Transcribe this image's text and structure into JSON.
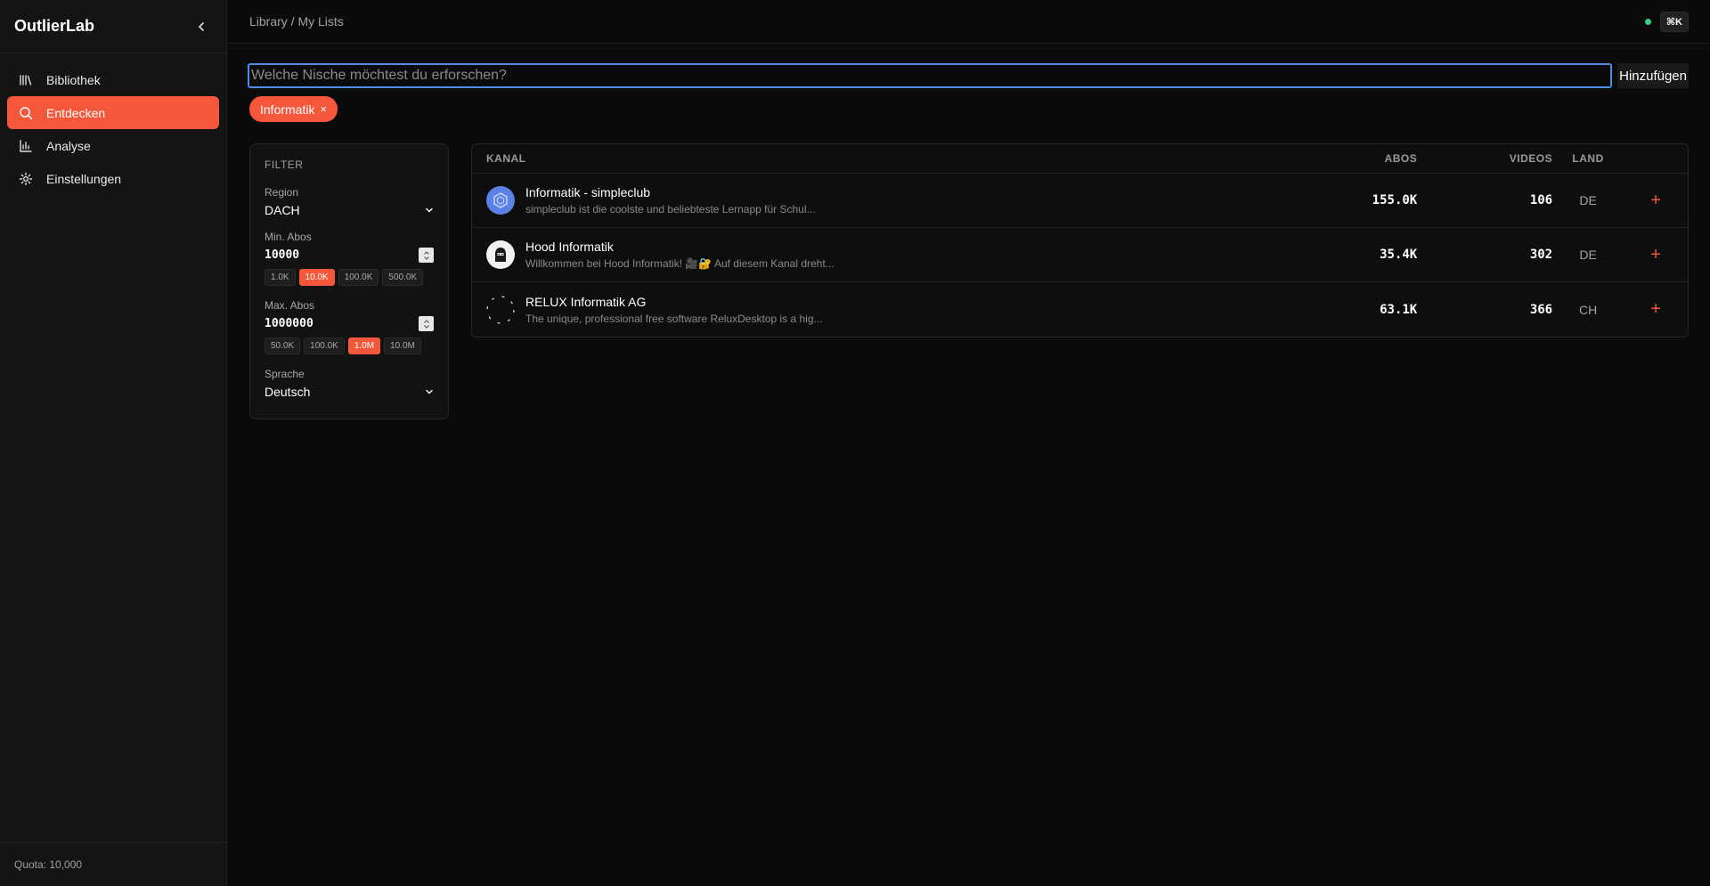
{
  "app": {
    "brand": "OutlierLab"
  },
  "sidebar": {
    "items": [
      {
        "label": "Bibliothek",
        "icon": "library-icon"
      },
      {
        "label": "Entdecken",
        "icon": "search-icon"
      },
      {
        "label": "Analyse",
        "icon": "bar-chart-icon"
      },
      {
        "label": "Einstellungen",
        "icon": "gear-icon"
      }
    ],
    "active": "Entdecken",
    "quota": "Quota: 10,000"
  },
  "topbar": {
    "breadcrumb": "Library / My Lists",
    "shortcut": "⌘K",
    "status_color": "#35d07f"
  },
  "search": {
    "placeholder": "Welche Nische möchtest du erforschen?",
    "value": "",
    "add_label": "Hinzufügen"
  },
  "chips": [
    {
      "label": "Informatik",
      "remove": "×"
    }
  ],
  "filter": {
    "title": "FILTER",
    "region": {
      "label": "Region",
      "value": "DACH"
    },
    "min_abos": {
      "label": "Min. Abos",
      "value": "10000",
      "presets": [
        "1.0K",
        "10.0K",
        "100.0K",
        "500.0K"
      ],
      "active": "10.0K"
    },
    "max_abos": {
      "label": "Max. Abos",
      "value": "1000000",
      "presets": [
        "50.0K",
        "100.0K",
        "1.0M",
        "10.0M"
      ],
      "active": "1.0M"
    },
    "language": {
      "label": "Sprache",
      "value": "Deutsch"
    }
  },
  "table": {
    "headers": {
      "kanal": "KANAL",
      "abos": "ABOS",
      "videos": "VIDEOS",
      "land": "LAND"
    },
    "rows": [
      {
        "name": "Informatik - simpleclub",
        "desc": "simpleclub ist die coolste und beliebteste Lernapp für Schul...",
        "abos": "155.0K",
        "videos": "106",
        "land": "DE",
        "add": "+"
      },
      {
        "name": "Hood Informatik",
        "desc": "Willkommen bei Hood Informatik! 🎥🔐 Auf diesem Kanal dreht...",
        "abos": "35.4K",
        "videos": "302",
        "land": "DE",
        "add": "+"
      },
      {
        "name": "RELUX Informatik AG",
        "desc": "The unique, professional free software ReluxDesktop is a hig...",
        "abos": "63.1K",
        "videos": "366",
        "land": "CH",
        "add": "+"
      }
    ]
  },
  "colors": {
    "accent": "#f5573a",
    "focus": "#4a8fe0"
  }
}
